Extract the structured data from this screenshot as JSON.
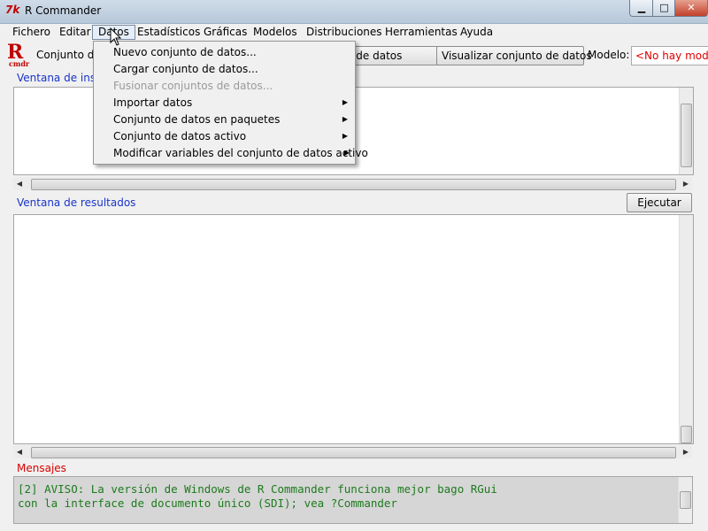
{
  "window": {
    "title": "R Commander",
    "tk_icon": "7k",
    "minimize_icon": "minimize-icon",
    "maximize_icon": "maximize-icon",
    "close_icon": "close-icon"
  },
  "menubar": {
    "items": [
      {
        "label": "Fichero"
      },
      {
        "label": "Editar"
      },
      {
        "label": "Datos"
      },
      {
        "label": "Estadísticos"
      },
      {
        "label": "Gráficas"
      },
      {
        "label": "Modelos"
      },
      {
        "label": "Distribuciones"
      },
      {
        "label": "Herramientas"
      },
      {
        "label": "Ayuda"
      }
    ]
  },
  "toolbar": {
    "dataset_label": "Conjunto de",
    "edit_dataset_label": "Editar conjunto de datos",
    "view_dataset_label": "Visualizar conjunto de datos",
    "model_label": "Modelo:",
    "model_value": "<No hay modelo activo>"
  },
  "script_window": {
    "label": "Ventana de instrucciones"
  },
  "output_window": {
    "label": "Ventana de resultados",
    "run_button": "Ejecutar"
  },
  "messages": {
    "label": "Mensajes",
    "lines": [
      "[2] AVISO: La versión de Windows de R Commander funciona mejor bago RGui",
      "con la interface de documento único (SDI); vea ?Commander"
    ]
  },
  "datos_menu": {
    "items": [
      {
        "label": "Nuevo conjunto de datos...",
        "enabled": true,
        "submenu": false
      },
      {
        "label": "Cargar conjunto de datos...",
        "enabled": true,
        "submenu": false
      },
      {
        "label": "Fusionar conjuntos de datos...",
        "enabled": false,
        "submenu": false
      },
      {
        "label": "Importar datos",
        "enabled": true,
        "submenu": true
      },
      {
        "label": "Conjunto de datos en paquetes",
        "enabled": true,
        "submenu": true
      },
      {
        "label": "Conjunto de datos activo",
        "enabled": true,
        "submenu": true
      },
      {
        "label": "Modificar variables del conjunto de datos activo",
        "enabled": true,
        "submenu": true
      }
    ]
  },
  "colors": {
    "section_blue": "#1a34c8",
    "section_red": "#d80000",
    "model_red": "#e00000",
    "message_green": "#1c7a1c"
  }
}
